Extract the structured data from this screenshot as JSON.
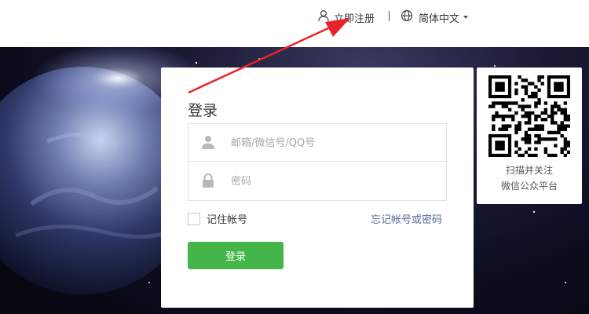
{
  "header": {
    "register_label": "立即注册",
    "register_icon": "user-icon",
    "language_label": "简体中文",
    "language_icon": "globe-icon"
  },
  "login": {
    "title": "登录",
    "account": {
      "placeholder": "邮箱/微信号/QQ号",
      "value": "",
      "icon": "user-icon"
    },
    "password": {
      "placeholder": "密码",
      "value": "",
      "icon": "lock-icon"
    },
    "remember_label": "记住帐号",
    "remember_checked": false,
    "forgot_label": "忘记帐号或密码",
    "submit_label": "登录"
  },
  "qrcode": {
    "line1": "扫描并关注",
    "line2": "微信公众平台"
  },
  "colors": {
    "primary_button": "#44b549",
    "link": "#576b95",
    "annotation_arrow": "#e8232a",
    "hero_background": "#0b0b1c"
  }
}
